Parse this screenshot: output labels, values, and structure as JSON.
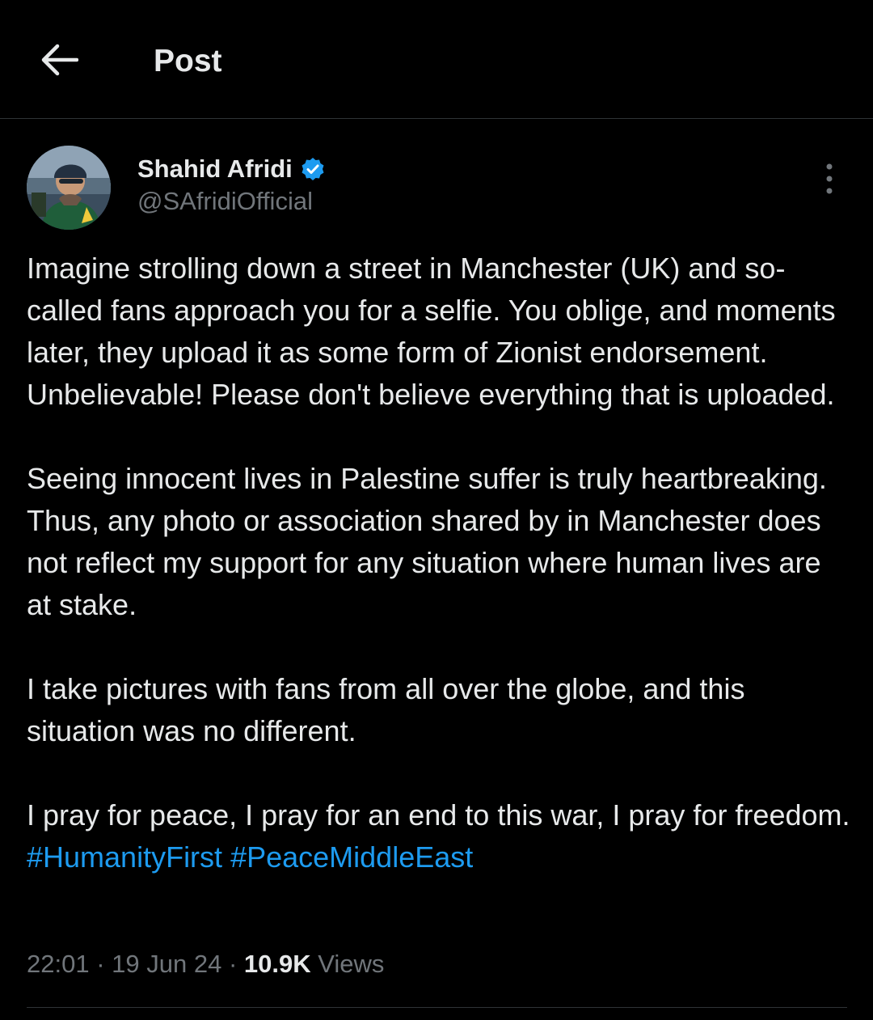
{
  "header": {
    "back_icon": "arrow-left-icon",
    "title": "Post"
  },
  "author": {
    "name": "Shahid Afridi",
    "handle": "@SAfridiOfficial",
    "verified_icon": "verified-badge-icon",
    "verified_color": "#1d9bf0"
  },
  "more_icon": "vertical-ellipsis-icon",
  "post": {
    "paragraphs": [
      "Imagine strolling down a street in Manchester (UK) and so-called fans approach you for a selfie. You oblige, and moments later, they upload it as some form of Zionist endorsement. Unbelievable! Please don't believe everything that is uploaded.",
      "Seeing innocent lives in Palestine suffer is truly heartbreaking. Thus, any photo or association shared by in Manchester does not reflect my support for any situation where human lives are at stake.",
      "I take pictures with fans from all over the globe, and this situation was no different.",
      "I pray for peace, I pray for an end to this war, I pray for freedom."
    ],
    "hashtags": [
      "#HumanityFirst",
      "#PeaceMiddleEast"
    ]
  },
  "meta": {
    "time": "22:01",
    "separator": "·",
    "date": "19 Jun 24",
    "views_count": "10.9K",
    "views_label": "Views"
  },
  "colors": {
    "background": "#000000",
    "text": "#e7e9ea",
    "secondary": "#71767b",
    "link": "#1d9bf0",
    "border": "#2f3336"
  }
}
